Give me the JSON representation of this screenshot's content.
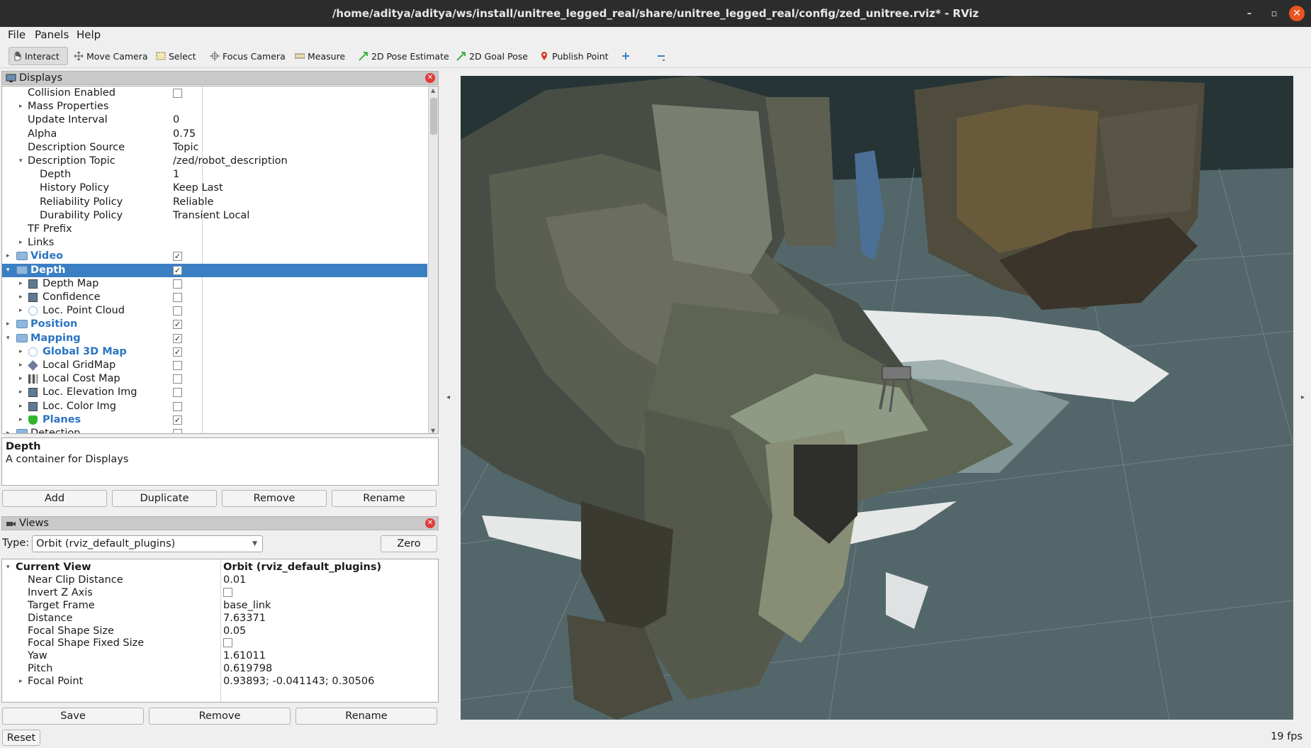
{
  "window": {
    "title": "/home/aditya/aditya/ws/install/unitree_legged_real/share/unitree_legged_real/config/zed_unitree.rviz* - RViz",
    "minimize": "–",
    "maximize": "▫",
    "close": "✕"
  },
  "menu": [
    "File",
    "Panels",
    "Help"
  ],
  "toolbar": {
    "interact": "Interact",
    "move_camera": "Move Camera",
    "select": "Select",
    "focus_camera": "Focus Camera",
    "measure": "Measure",
    "pose_estimate": "2D Pose Estimate",
    "goal_pose": "2D Goal Pose",
    "publish_point": "Publish Point"
  },
  "displays": {
    "title": "Displays",
    "rows": [
      {
        "label": "Collision Enabled",
        "value": "",
        "checkbox": true,
        "checked": false
      },
      {
        "label": "Mass Properties",
        "value": ""
      },
      {
        "label": "Update Interval",
        "value": "0"
      },
      {
        "label": "Alpha",
        "value": "0.75"
      },
      {
        "label": "Description Source",
        "value": "Topic"
      },
      {
        "label": "Description Topic",
        "value": "/zed/robot_description"
      },
      {
        "label": "Depth",
        "value": "1"
      },
      {
        "label": "History Policy",
        "value": "Keep Last"
      },
      {
        "label": "Reliability Policy",
        "value": "Reliable"
      },
      {
        "label": "Durability Policy",
        "value": "Transient Local"
      },
      {
        "label": "TF Prefix",
        "value": ""
      },
      {
        "label": "Links",
        "value": ""
      },
      {
        "label": "Video",
        "checked": true
      },
      {
        "label": "Depth",
        "checked": true
      },
      {
        "label": "Depth Map",
        "checked": false
      },
      {
        "label": "Confidence",
        "checked": false
      },
      {
        "label": "Loc. Point Cloud",
        "checked": false
      },
      {
        "label": "Position",
        "checked": true
      },
      {
        "label": "Mapping",
        "checked": true
      },
      {
        "label": "Global 3D Map",
        "checked": true
      },
      {
        "label": "Local GridMap",
        "checked": false
      },
      {
        "label": "Local Cost Map",
        "checked": false
      },
      {
        "label": "Loc. Elevation Img",
        "checked": false
      },
      {
        "label": "Loc. Color Img",
        "checked": false
      },
      {
        "label": "Planes",
        "checked": true
      },
      {
        "label": "Detection",
        "checked": false
      }
    ]
  },
  "description": {
    "title": "Depth",
    "text": "A container for Displays"
  },
  "display_buttons": [
    "Add",
    "Duplicate",
    "Remove",
    "Rename"
  ],
  "views": {
    "title": "Views",
    "type_label": "Type:",
    "type_value": "Orbit (rviz_default_plugins)",
    "zero": "Zero",
    "rows": [
      {
        "label": "Current View",
        "value": "Orbit (rviz_default_plugins)"
      },
      {
        "label": "Near Clip Distance",
        "value": "0.01"
      },
      {
        "label": "Invert Z Axis",
        "value": ""
      },
      {
        "label": "Target Frame",
        "value": "base_link"
      },
      {
        "label": "Distance",
        "value": "7.63371"
      },
      {
        "label": "Focal Shape Size",
        "value": "0.05"
      },
      {
        "label": "Focal Shape Fixed Size",
        "value": ""
      },
      {
        "label": "Yaw",
        "value": "1.61011"
      },
      {
        "label": "Pitch",
        "value": "0.619798"
      },
      {
        "label": "Focal Point",
        "value": "0.93893; -0.041143; 0.30506"
      }
    ],
    "buttons": [
      "Save",
      "Remove",
      "Rename"
    ]
  },
  "status": {
    "reset": "Reset",
    "fps": "19 fps"
  },
  "colors": {
    "selection": "#3a7fc4",
    "link_blue": "#2b74c2",
    "viewport_bg": "#263436",
    "ground": "#54676a"
  }
}
